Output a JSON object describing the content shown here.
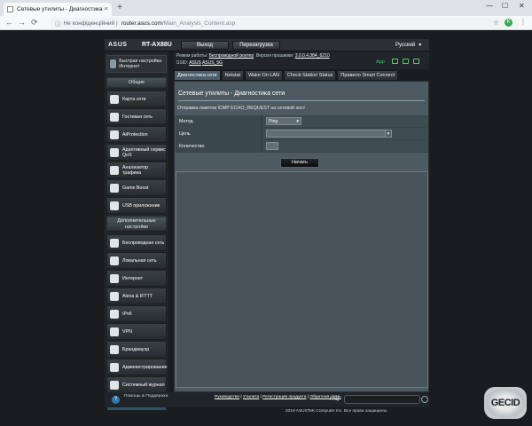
{
  "browser": {
    "tab_title": "Сетевые утилиты - Диагностика сети",
    "tab_close": "×",
    "new_tab": "+",
    "win_min": "—",
    "win_max": "☐",
    "win_close": "✕",
    "back": "←",
    "forward": "→",
    "reload": "⟳",
    "info": "ⓘ",
    "secure_label": "Не конфіденційний |",
    "url_host": "router.asus.com",
    "url_path": "/Main_Analysis_Content.asp",
    "star": "☆",
    "ext": "K",
    "menu": "⋮"
  },
  "header": {
    "logo": "ASUS",
    "model": "RT-AX88U",
    "logout": "Выход",
    "reboot": "Перезагрузка",
    "language": "Русский"
  },
  "status": {
    "mode_label": "Режим работы:",
    "mode_value": "Беспроводной роутер",
    "firmware_label": "Версия прошивки:",
    "firmware_value": "3.0.0.4.384_6210",
    "ssid_label": "SSID:",
    "ssid_1": "ASUS",
    "ssid_2": "ASUS_5G",
    "app_label": "App"
  },
  "sidebar": {
    "qis": "Быстрая настройка Интернет",
    "general_title": "Общие",
    "general": [
      {
        "label": "Карта сети",
        "icon": "network-map-icon"
      },
      {
        "label": "Гостевая сеть",
        "icon": "guest-network-icon"
      },
      {
        "label": "AiProtection",
        "icon": "aiprotection-icon"
      },
      {
        "label": "Адаптивный сервис QoS",
        "icon": "qos-icon"
      },
      {
        "label": "Анализатор трафика",
        "icon": "traffic-analyzer-icon"
      },
      {
        "label": "Game Boost",
        "icon": "game-boost-icon"
      },
      {
        "label": "USB приложение",
        "icon": "usb-icon"
      },
      {
        "label": "AiCloud 2.0",
        "icon": "aicloud-icon"
      }
    ],
    "advanced_title": "Дополнительные настройки",
    "advanced": [
      {
        "label": "Беспроводная сеть",
        "icon": "wireless-icon"
      },
      {
        "label": "Локальная сеть",
        "icon": "lan-icon"
      },
      {
        "label": "Интернет",
        "icon": "wan-icon"
      },
      {
        "label": "Alexa & IFTTT",
        "icon": "alexa-icon"
      },
      {
        "label": "IPv6",
        "icon": "ipv6-icon"
      },
      {
        "label": "VPN",
        "icon": "vpn-icon"
      },
      {
        "label": "Брандмауэр",
        "icon": "firewall-icon"
      },
      {
        "label": "Администрирование",
        "icon": "administration-icon"
      },
      {
        "label": "Системный журнал",
        "icon": "system-log-icon"
      },
      {
        "label": "Сетевые утилиты",
        "icon": "network-tools-icon"
      }
    ]
  },
  "tabs": [
    "Диагностика сети",
    "Netstat",
    "Wake On LAN",
    "Check Station Status",
    "Правило Smart Connect"
  ],
  "main": {
    "title": "Сетевые утилиты - Диагностика сети",
    "description": "Отправка пакетов ICMP ECHO_REQUEST на сетевой хост",
    "method_label": "Метод",
    "method_value": "Ping",
    "target_label": "Цель",
    "count_label": "Количество",
    "start_button": "Начать"
  },
  "footer": {
    "help_icon": "?",
    "help_label": "Помощь & Поддержка",
    "manual": "Руководство",
    "utility": "Утилита",
    "registration": "Регистрация продукта",
    "feedback": "Обратная связь",
    "faq": "FAQ",
    "copyright": "2019 ASUSTeK Computer Inc. Все права защищены."
  },
  "watermark": "GECID"
}
